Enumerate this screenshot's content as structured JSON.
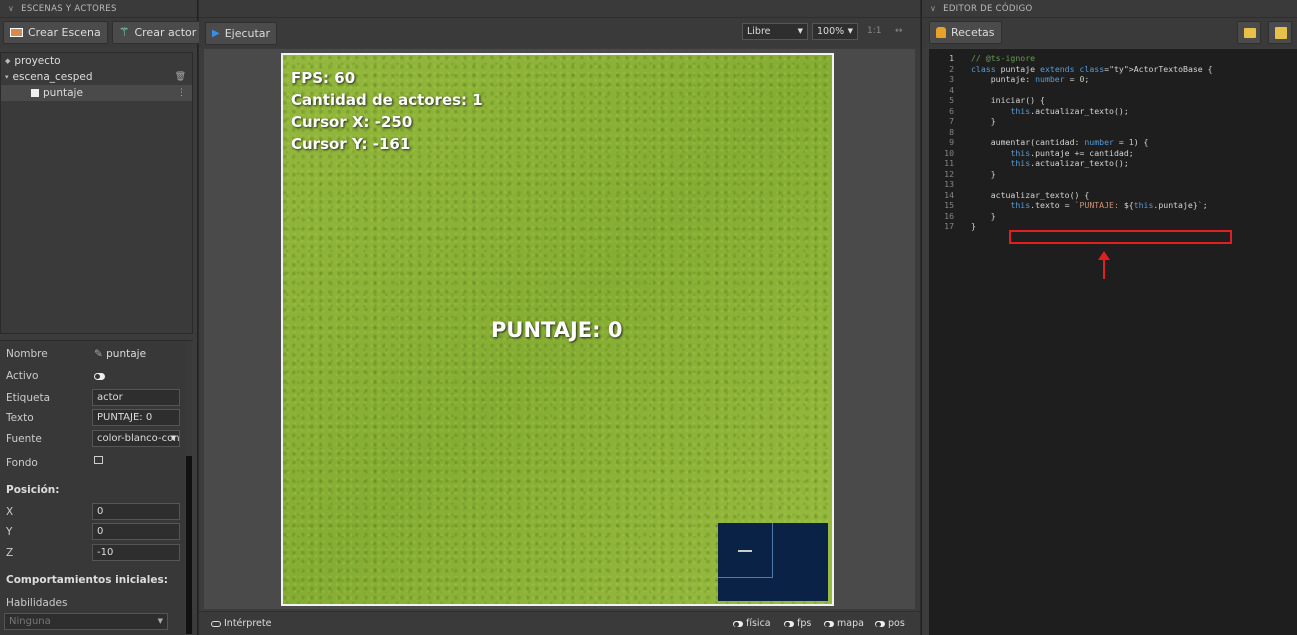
{
  "left_panel": {
    "header": "ESCENAS Y ACTORES",
    "buttons": {
      "create_scene": "Crear Escena",
      "create_actor": "Crear actor"
    },
    "tree": {
      "project": "proyecto",
      "scene": "escena_cesped",
      "actor": "puntaje"
    },
    "properties": {
      "name_label": "Nombre",
      "name_value": "puntaje",
      "active_label": "Activo",
      "tag_label": "Etiqueta",
      "tag_value": "actor",
      "text_label": "Texto",
      "text_value": "PUNTAJE: 0",
      "font_label": "Fuente",
      "font_value": "color-blanco-con",
      "background_label": "Fondo",
      "position_title": "Posición:",
      "x_label": "X",
      "x_value": "0",
      "y_label": "Y",
      "y_value": "0",
      "z_label": "Z",
      "z_value": "-10",
      "behaviors_title": "Comportamientos iniciales:",
      "skills_label": "Habilidades",
      "skills_value": "Ninguna"
    }
  },
  "center_panel": {
    "run_button": "Ejecutar",
    "camera_mode": "Libre",
    "zoom": "100%",
    "ratio": "1:1",
    "expand_icon": "↔",
    "hud": {
      "fps": "FPS: 60",
      "actors": "Cantidad de actores: 1",
      "cursor_x": "Cursor X: -250",
      "cursor_y": "Cursor Y: -161"
    },
    "score_text": "PUNTAJE: 0",
    "bottom": {
      "interpreter": "Intérprete",
      "physics": "física",
      "fps": "fps",
      "map": "mapa",
      "pos": "pos"
    }
  },
  "right_panel": {
    "header": "EDITOR DE CÓDIGO",
    "recipes_button": "Recetas",
    "current_line": 1,
    "code_lines": [
      "// @ts-ignore",
      "class puntaje extends ActorTextoBase {",
      "    puntaje: number = 0;",
      "",
      "    iniciar() {",
      "        this.actualizar_texto();",
      "    }",
      "",
      "    aumentar(cantidad: number = 1) {",
      "        this.puntaje += cantidad;",
      "        this.actualizar_texto();",
      "    }",
      "",
      "    actualizar_texto() {",
      "        this.texto = `PUNTAJE: ${this.puntaje}`;",
      "    }",
      "}"
    ]
  },
  "colors": {
    "highlight": "#e02020",
    "grass": "#8fb33a",
    "minimap": "#0a2245",
    "run_icon": "#3a8ee6"
  }
}
